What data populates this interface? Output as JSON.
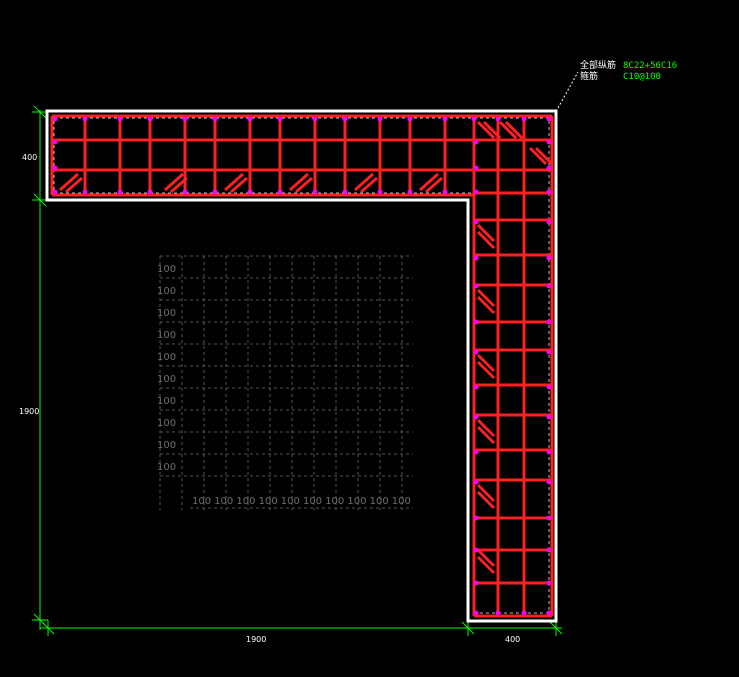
{
  "annotation": {
    "longitudinal_label": "全部纵筋",
    "longitudinal_value": "8C22+56C16",
    "stirrup_label": "箍筋",
    "stirrup_value": "C10@100"
  },
  "dimensions": {
    "left_height": "1900",
    "top_thickness": "400",
    "bottom_width": "1900",
    "bottom_thickness": "400"
  },
  "grid": {
    "row_labels": [
      "100",
      "100",
      "100",
      "100",
      "100",
      "100",
      "100",
      "100",
      "100",
      "100"
    ],
    "col_labels": [
      "100",
      "100",
      "100",
      "100",
      "100",
      "100",
      "100",
      "100",
      "100",
      "100"
    ]
  },
  "colors": {
    "background": "#000000",
    "outline": "#ffffff",
    "stirrup": "#ff2020",
    "rebar_dot": "#ff00ff",
    "dimension": "#00ff00",
    "grid": "#555555"
  }
}
